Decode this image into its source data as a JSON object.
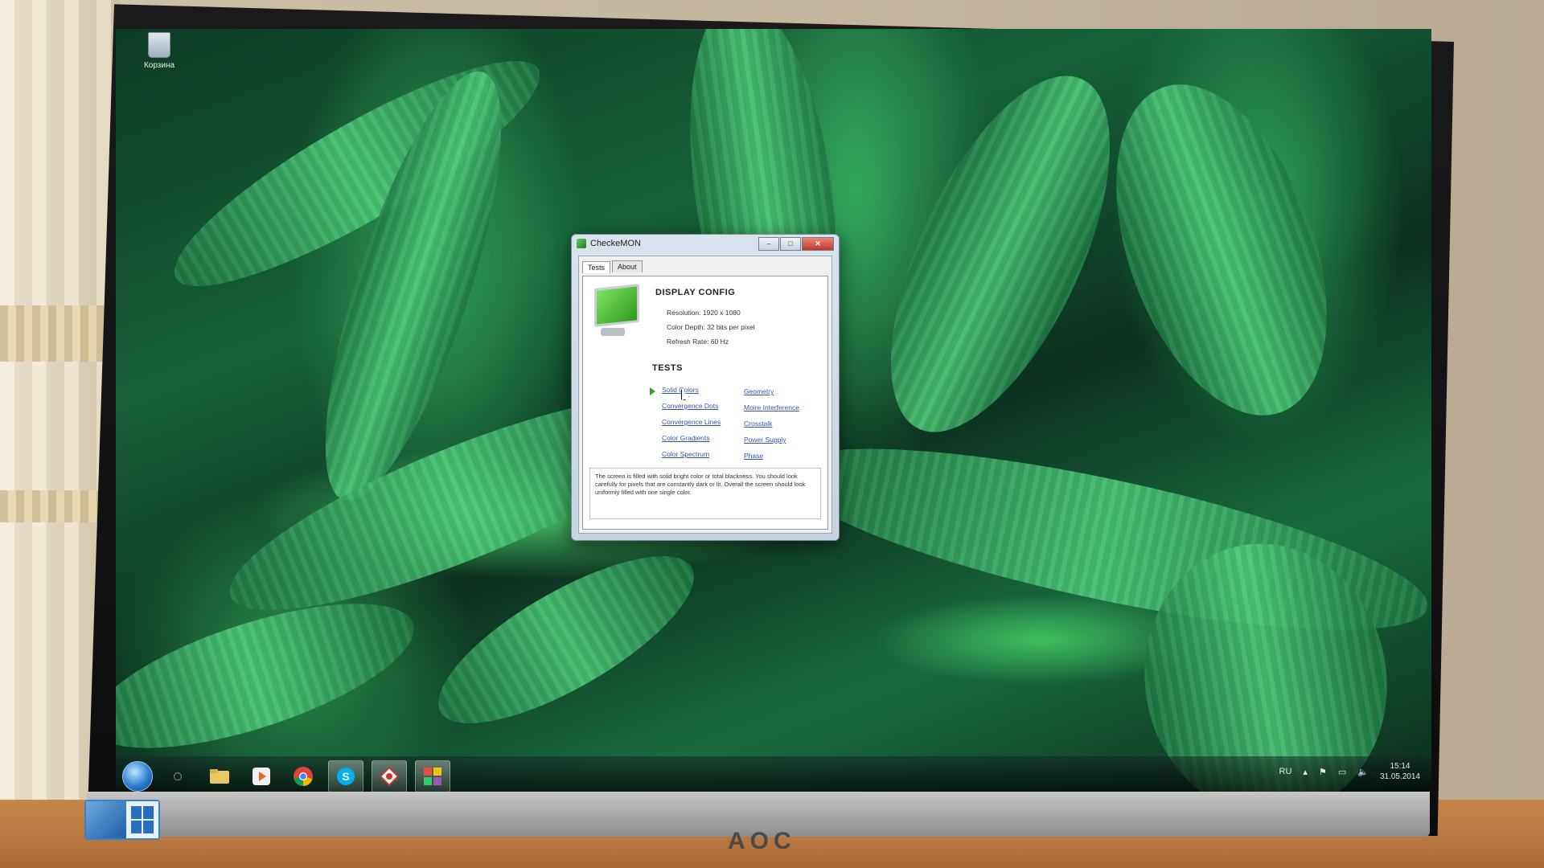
{
  "desktop": {
    "recycle_bin_label": "Корзина"
  },
  "window": {
    "title": "CheckeMON",
    "tabs": [
      {
        "label": "Tests",
        "active": true
      },
      {
        "label": "About",
        "active": false
      }
    ],
    "display_config": {
      "heading": "DISPLAY CONFIG",
      "resolution": "Resolution: 1920 x 1080",
      "color_depth": "Color Depth: 32 bits per pixel",
      "refresh_rate": "Refresh Rate: 60 Hz"
    },
    "tests": {
      "heading": "TESTS",
      "left_column": [
        "Solid Colors",
        "Convergence Dots",
        "Convergence Lines",
        "Color Gradients",
        "Color Spectrum"
      ],
      "right_column": [
        "Geometry",
        "Moire Interference",
        "Crosstalk",
        "Power Supply",
        "Phase"
      ]
    },
    "description": "The screen is filled with solid bright color or total blackness. You should look carefully for pixels that are constantly dark or lit. Overall the screen should look uniformly filled with one single color."
  },
  "taskbar": {
    "language": "RU",
    "time": "15:14",
    "date": "31.05.2014",
    "pinned": [
      {
        "icon": "tray-circle-icon",
        "active": false
      },
      {
        "icon": "explorer-folder-icon",
        "active": false
      },
      {
        "icon": "media-player-icon",
        "active": false
      },
      {
        "icon": "chrome-icon",
        "active": false
      },
      {
        "icon": "skype-icon",
        "active": true
      },
      {
        "icon": "diamond-app-icon",
        "active": true
      },
      {
        "icon": "checkemon-icon",
        "active": true
      }
    ]
  },
  "monitor": {
    "brand": "AOC"
  }
}
